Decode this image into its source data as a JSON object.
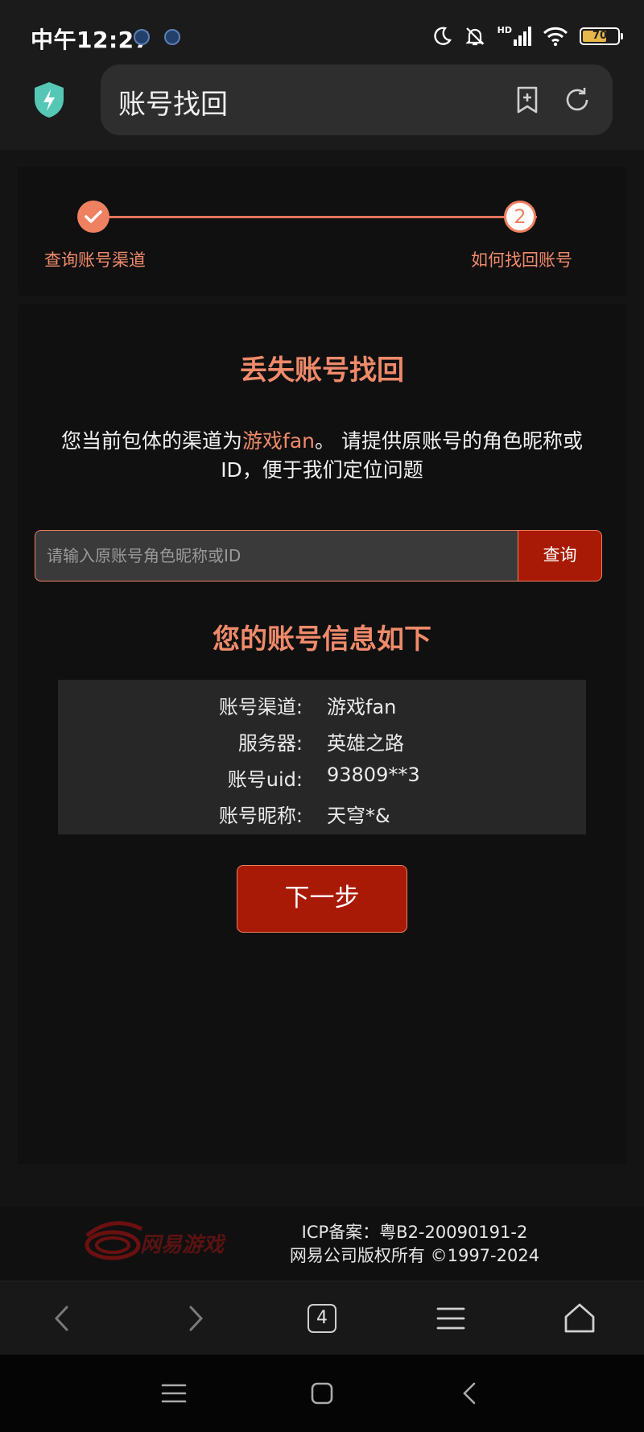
{
  "status_bar": {
    "time": "中午12:27",
    "hd": "HD",
    "battery": "70",
    "battery_level": 0.7
  },
  "browser": {
    "page_title": "账号找回",
    "icons": [
      "shield-bolt-icon",
      "bookmark-add-icon",
      "refresh-icon"
    ]
  },
  "steps": {
    "step1_label": "查询账号渠道",
    "step2_label": "如何找回账号",
    "step2_number": "2",
    "step1_state": "completed"
  },
  "main": {
    "title": "丢失账号找回",
    "desc_prefix": "您当前包体的渠道为",
    "desc_channel": "游戏fan",
    "desc_suffix": "。 请提供原账号的角色昵称或ID，便于我们定位问题",
    "search": {
      "placeholder": "请输入原账号角色昵称或ID",
      "value": "",
      "button": "查询"
    },
    "info_title": "您的账号信息如下",
    "info": [
      {
        "label": "账号渠道:",
        "value": "游戏fan"
      },
      {
        "label": "服务器:",
        "value": "英雄之路"
      },
      {
        "label": "账号uid:",
        "value": "93809**3"
      },
      {
        "label": "账号昵称:",
        "value": "天穹*&"
      }
    ],
    "next_button": "下一步"
  },
  "footer": {
    "logo_text": "网易游戏",
    "icp": "ICP备案：粤B2-20090191-2",
    "copyright": "网易公司版权所有 ©1997-2024"
  },
  "browser_nav": {
    "tab_count": "4"
  },
  "colors": {
    "accent": "#ef8060",
    "button": "#a81a06",
    "background": "#141414"
  }
}
